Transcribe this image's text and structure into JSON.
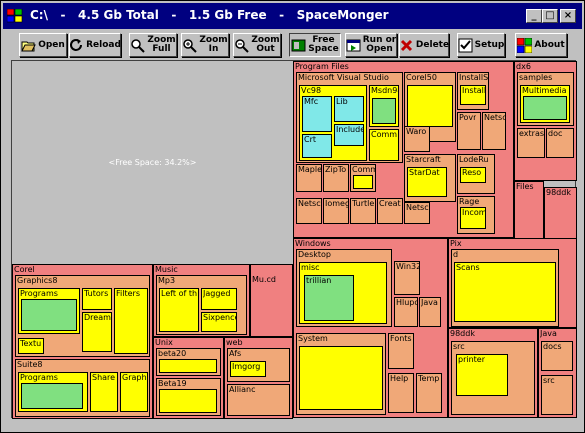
{
  "window": {
    "title": "C:\\   -   4.5 Gb Total   -   1.5 Gb Free   -   SpaceMonger",
    "controls": {
      "minimize": "_",
      "maximize": "□",
      "close": "×"
    }
  },
  "toolbar": {
    "open": "Open",
    "reload": "Reload",
    "zoom_full": "Zoom\nFull",
    "zoom_in": "Zoom\nIn",
    "zoom_out": "Zoom\nOut",
    "free_space": "Free\nSpace",
    "run_or_open": "Run or\nOpen",
    "delete": "Delete",
    "setup": "Setup",
    "about": "About"
  },
  "map": {
    "free_label": "<Free Space: 34.2%>",
    "folders": {
      "program_files": "Program Files",
      "msvs": "Microsoft Visual Studio",
      "vc98": "Vc98",
      "mfc": "Mfc",
      "lib": "Lib",
      "crt": "Crt",
      "include": "Include",
      "msdn98": "Msdn98",
      "common": "Comm",
      "maple": "Maple",
      "zipto": "ZipTo",
      "comm2": "Comm",
      "netsc": "Netsc",
      "iomega": "Iomeg",
      "turtle": "Turtle",
      "creat": "Creat",
      "corel50": "Corel50",
      "waro": "Waro",
      "starcraft": "Starcraft",
      "stardat": "StarDat",
      "netsc2": "Netsc",
      "installs": "InstallS",
      "install": "Install",
      "povr": "Povr",
      "netsc3": "Netsc",
      "loderun": "LodeRu",
      "reso": "Reso",
      "rage": "Rage",
      "incom": "Incom",
      "dx6": "dx6",
      "samples": "samples",
      "multimedia": "Multimedia",
      "extras": "extras",
      "doc": "doc",
      "files": "Files",
      "98ddk_top": "98ddk",
      "windows": "Windows",
      "desktop": "Desktop",
      "misc": "misc",
      "trillian": "trillian",
      "win32": "Win32",
      "hlupo": "Hlupo",
      "java": "Java",
      "system": "System",
      "fonts": "Fonts",
      "help": "Help",
      "temp": "Temp",
      "pix": "Pix",
      "d": "d",
      "scans": "Scans",
      "98ddk": "98ddk",
      "src": "src",
      "printer": "printer",
      "java2": "Java",
      "docs": "docs",
      "src2": "src",
      "corel": "Corel",
      "graphics8": "Graphics8",
      "programs": "Programs",
      "tutors": "Tutors",
      "filters": "Filters",
      "dream": "Dream",
      "textu": "Textu",
      "suite8": "Suite8",
      "programs2": "Programs",
      "share": "Share",
      "graph": "Graph",
      "music": "Music",
      "mp3": "Mp3",
      "left_of_the": "Left of th",
      "jagged": "Jagged",
      "sixpence": "Sixpence",
      "mucd": "Mu.cd",
      "unix": "Unix",
      "beta20": "beta20",
      "beta19": "Beta19",
      "web": "web",
      "afs": "Afs",
      "imgorg": "Imgorg",
      "alliance": "Allianc"
    }
  },
  "colors": {
    "title_bar": "#000080",
    "folder_pink": "#f08080",
    "folder_salmon": "#f0a878",
    "file_yellow": "#ffff00",
    "file_green": "#80e080",
    "file_cyan": "#80e8e8",
    "free_space": "#c0c0c0"
  }
}
